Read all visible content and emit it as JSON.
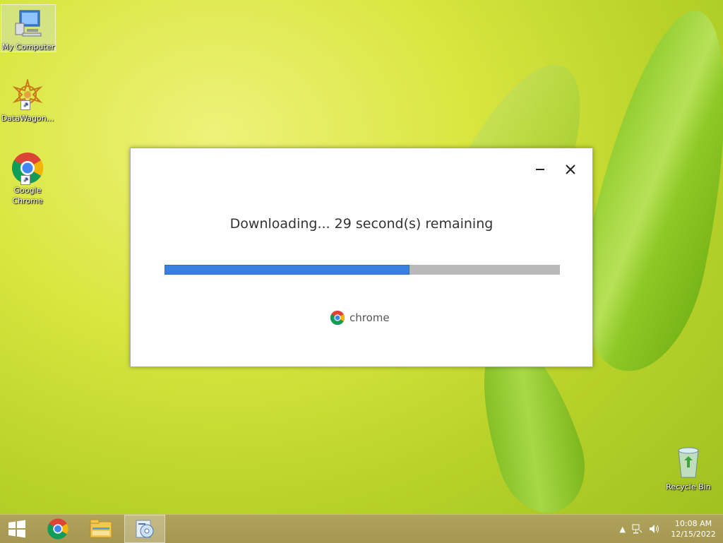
{
  "desktop": {
    "icons": [
      {
        "label": "My Computer"
      },
      {
        "label": "DataWagon..."
      },
      {
        "label": "Google Chrome"
      },
      {
        "label": "Recycle Bin"
      }
    ]
  },
  "dialog": {
    "status": "Downloading... 29 second(s) remaining",
    "progress_fraction": 0.62,
    "brand": "chrome",
    "colors": {
      "progress_fill": "#3a7fe0",
      "progress_track": "#b9b9b9"
    }
  },
  "taskbar": {
    "items": [
      "windows-start-icon",
      "chrome-icon",
      "file-explorer-icon",
      "installer-icon"
    ],
    "clock": {
      "time": "10:08 AM",
      "date": "12/15/2022"
    }
  }
}
